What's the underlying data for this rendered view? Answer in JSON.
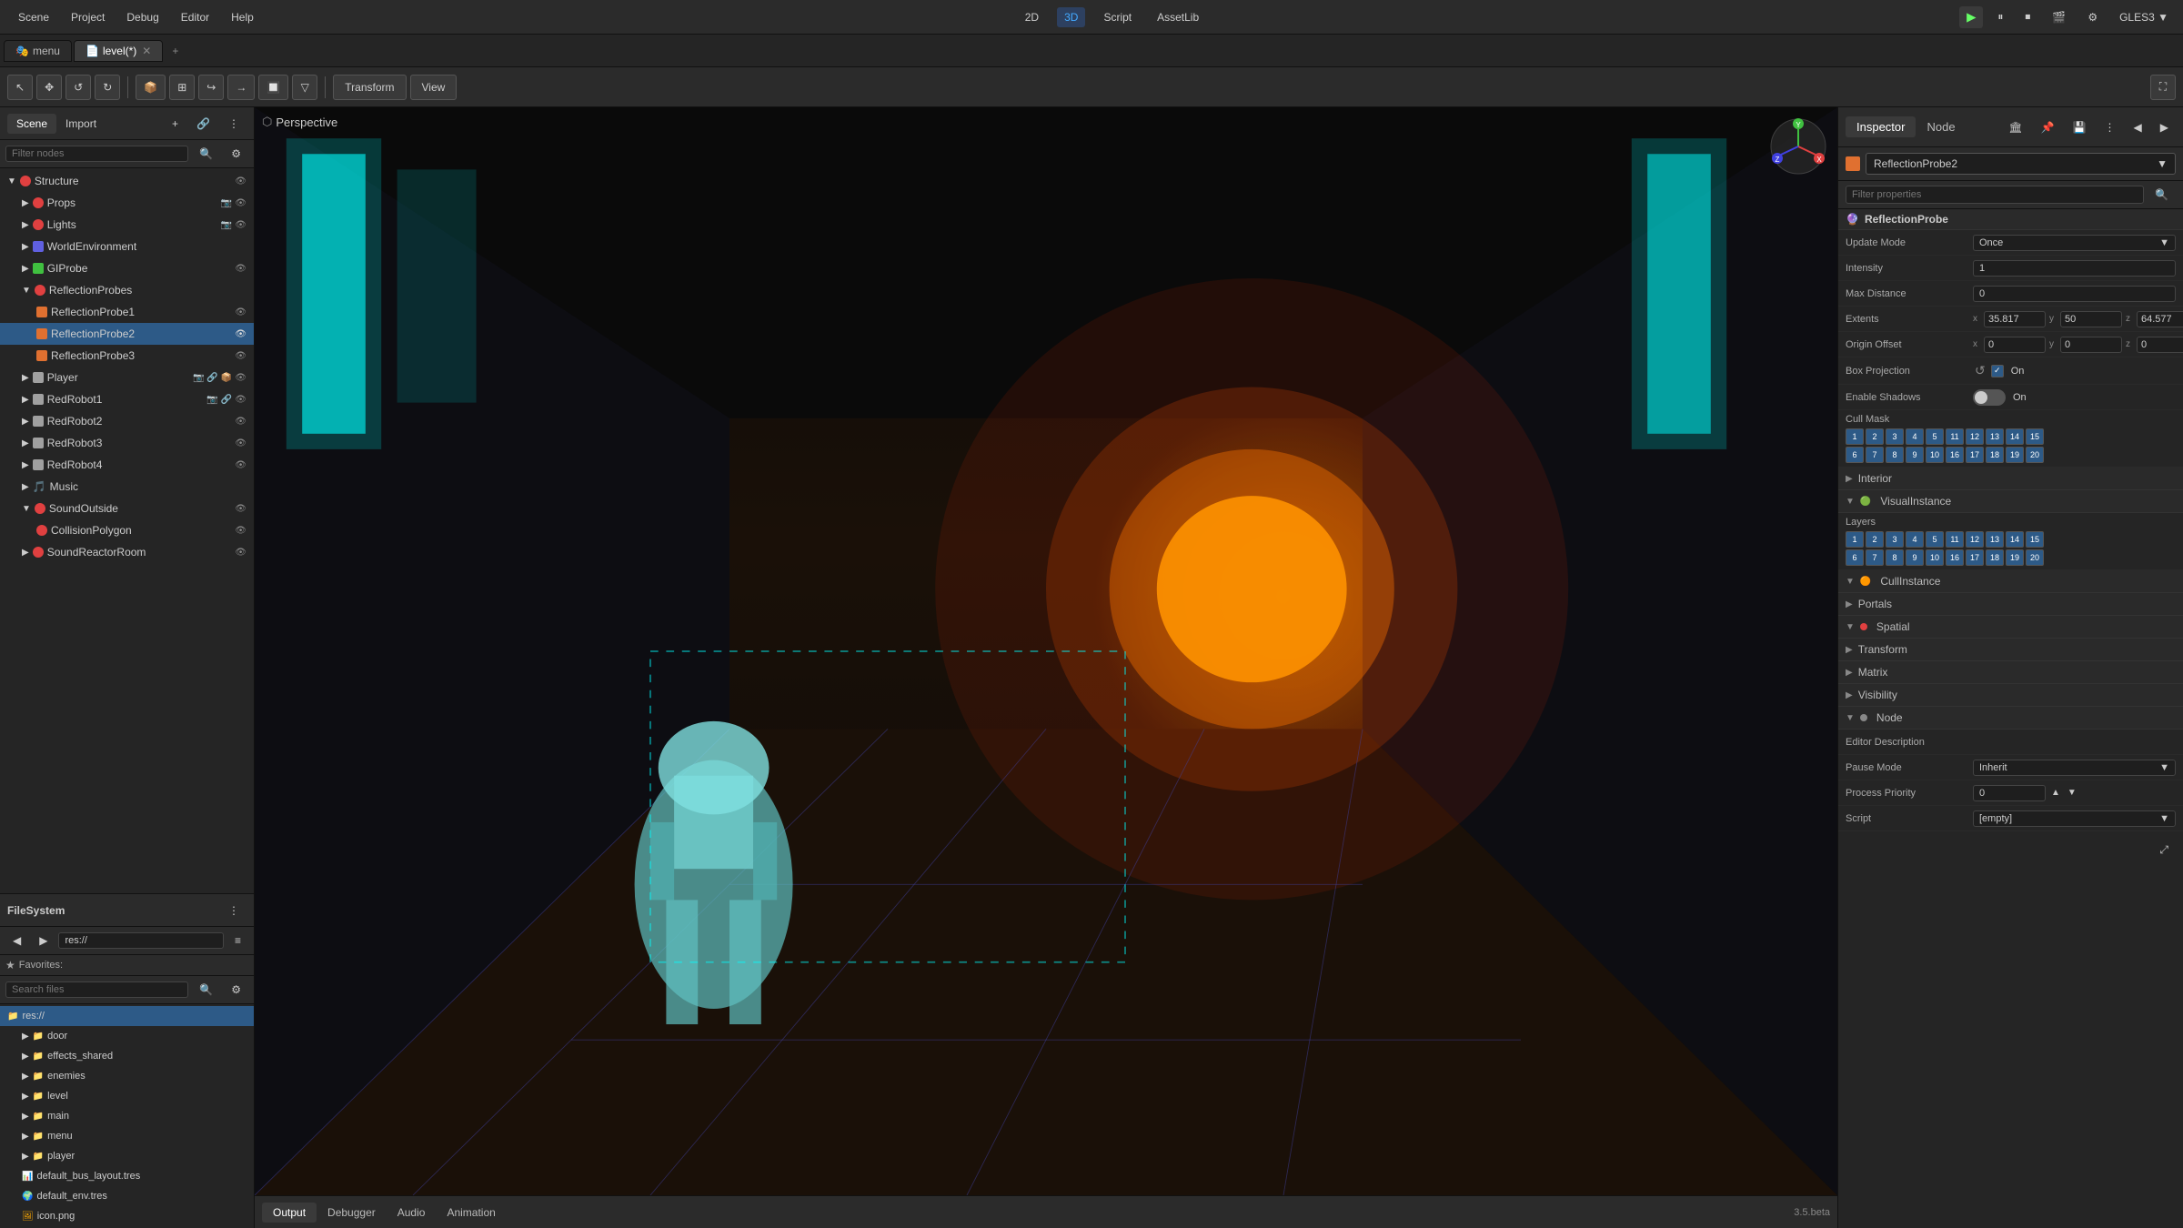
{
  "topbar": {
    "menu_items": [
      "Scene",
      "Project",
      "Debug",
      "Editor",
      "Help"
    ],
    "center": {
      "mode_2d": "2D",
      "mode_3d": "3D",
      "script": "Script",
      "assetlib": "AssetLib"
    },
    "right": {
      "renderer": "GLES3 ▼"
    },
    "run_icon": "▶",
    "pause_icon": "⏸",
    "stop_icon": "⏹",
    "movie_icon": "🎬",
    "settings_icon": "⚙"
  },
  "tabs": {
    "items": [
      {
        "label": "menu",
        "icon": "🎭",
        "active": false,
        "closeable": false
      },
      {
        "label": "level(*)",
        "icon": "📄",
        "active": true,
        "closeable": true
      }
    ],
    "add_label": "+"
  },
  "toolbar": {
    "tools": [
      "↖",
      "✥",
      "↺",
      "↻",
      "📦",
      "⊞",
      "↪",
      "→",
      "🔲",
      "▽"
    ],
    "transform_label": "Transform",
    "view_label": "View"
  },
  "scene_panel": {
    "tabs": [
      "Scene",
      "Import"
    ],
    "active_tab": "Scene",
    "filter_placeholder": "Filter nodes",
    "tree": [
      {
        "label": "Structure",
        "icon": "🔴",
        "indent": 0,
        "type": "node",
        "has_eye": true,
        "expanded": true
      },
      {
        "label": "Props",
        "icon": "🔴",
        "indent": 1,
        "type": "node",
        "has_eye": true,
        "expanded": false
      },
      {
        "label": "Lights",
        "icon": "🔴",
        "indent": 1,
        "type": "node",
        "has_eye": true,
        "expanded": false
      },
      {
        "label": "WorldEnvironment",
        "icon": "🌍",
        "indent": 1,
        "type": "node",
        "has_eye": false,
        "expanded": false
      },
      {
        "label": "GIProbe",
        "icon": "🟢",
        "indent": 1,
        "type": "node",
        "has_eye": true,
        "expanded": false
      },
      {
        "label": "ReflectionProbes",
        "icon": "🔴",
        "indent": 1,
        "type": "node",
        "has_eye": false,
        "expanded": true
      },
      {
        "label": "ReflectionProbe1",
        "icon": "🔴",
        "indent": 2,
        "type": "node",
        "has_eye": true,
        "expanded": false
      },
      {
        "label": "ReflectionProbe2",
        "icon": "🔴",
        "indent": 2,
        "type": "node",
        "has_eye": true,
        "expanded": false,
        "selected": true
      },
      {
        "label": "ReflectionProbe3",
        "icon": "🔴",
        "indent": 2,
        "type": "node",
        "has_eye": true,
        "expanded": false
      },
      {
        "label": "Player",
        "icon": "⬜",
        "indent": 1,
        "type": "node",
        "has_eye": true,
        "expanded": false
      },
      {
        "label": "RedRobot1",
        "icon": "⬜",
        "indent": 1,
        "type": "node",
        "has_eye": true,
        "expanded": false
      },
      {
        "label": "RedRobot2",
        "icon": "⬜",
        "indent": 1,
        "type": "node",
        "has_eye": true,
        "expanded": false
      },
      {
        "label": "RedRobot3",
        "icon": "⬜",
        "indent": 1,
        "type": "node",
        "has_eye": true,
        "expanded": false
      },
      {
        "label": "RedRobot4",
        "icon": "⬜",
        "indent": 1,
        "type": "node",
        "has_eye": true,
        "expanded": false
      },
      {
        "label": "Music",
        "icon": "🎵",
        "indent": 1,
        "type": "node",
        "has_eye": false,
        "expanded": false
      },
      {
        "label": "SoundOutside",
        "icon": "🔴",
        "indent": 1,
        "type": "node",
        "has_eye": true,
        "expanded": true
      },
      {
        "label": "CollisionPolygon",
        "icon": "🔴",
        "indent": 2,
        "type": "node",
        "has_eye": true,
        "expanded": false
      },
      {
        "label": "SoundReactorRoom",
        "icon": "🔴",
        "indent": 1,
        "type": "node",
        "has_eye": true,
        "expanded": false
      }
    ]
  },
  "filesystem_panel": {
    "title": "FileSystem",
    "path": "res://",
    "search_placeholder": "Search files",
    "favorites_label": "Favorites:",
    "items": [
      {
        "label": "res://",
        "icon": "📁",
        "indent": 0,
        "type": "folder",
        "expanded": true,
        "selected": true
      },
      {
        "label": "door",
        "icon": "📁",
        "indent": 1,
        "type": "folder",
        "expanded": false
      },
      {
        "label": "effects_shared",
        "icon": "📁",
        "indent": 1,
        "type": "folder",
        "expanded": false
      },
      {
        "label": "enemies",
        "icon": "📁",
        "indent": 1,
        "type": "folder",
        "expanded": false
      },
      {
        "label": "level",
        "icon": "📁",
        "indent": 1,
        "type": "folder",
        "expanded": false
      },
      {
        "label": "main",
        "icon": "📁",
        "indent": 1,
        "type": "folder",
        "expanded": false
      },
      {
        "label": "menu",
        "icon": "📁",
        "indent": 1,
        "type": "folder",
        "expanded": false
      },
      {
        "label": "player",
        "icon": "📁",
        "indent": 1,
        "type": "folder",
        "expanded": false
      },
      {
        "label": "default_bus_layout.tres",
        "icon": "📊",
        "indent": 1,
        "type": "file"
      },
      {
        "label": "default_env.tres",
        "icon": "🌍",
        "indent": 1,
        "type": "file"
      },
      {
        "label": "icon.png",
        "icon": "🖼",
        "indent": 1,
        "type": "file"
      }
    ]
  },
  "viewport": {
    "perspective_label": "Perspective",
    "gizmo_colors": {
      "x": "#e04040",
      "y": "#40c040",
      "z": "#4040e0"
    }
  },
  "inspector": {
    "tabs": [
      "Inspector",
      "Node"
    ],
    "active_tab": "Inspector",
    "selected_node": "ReflectionProbe2",
    "filter_placeholder": "Filter properties",
    "section_label": "ReflectionProbe",
    "properties": {
      "update_mode": {
        "label": "Update Mode",
        "value": "Once"
      },
      "intensity": {
        "label": "Intensity",
        "value": "1"
      },
      "max_distance": {
        "label": "Max Distance",
        "value": "0"
      },
      "extents": {
        "label": "Extents",
        "x": "35.817",
        "y": "50",
        "z": "64.577"
      },
      "origin_offset": {
        "label": "Origin Offset",
        "x": "0",
        "y": "0",
        "z": "0"
      },
      "box_projection": {
        "label": "Box Projection",
        "value": "On",
        "enabled": true
      },
      "enable_shadows": {
        "label": "Enable Shadows",
        "value": "On",
        "enabled": false
      },
      "cull_mask": {
        "label": "Cull Mask",
        "rows": [
          [
            {
              "num": 1,
              "on": true
            },
            {
              "num": 2,
              "on": true
            },
            {
              "num": 3,
              "on": true
            },
            {
              "num": 4,
              "on": true
            },
            {
              "num": 5,
              "on": true
            },
            {
              "num": 11,
              "on": true
            },
            {
              "num": 12,
              "on": true
            },
            {
              "num": 13,
              "on": true
            },
            {
              "num": 14,
              "on": true
            },
            {
              "num": 15,
              "on": true
            }
          ],
          [
            {
              "num": 6,
              "on": true
            },
            {
              "num": 7,
              "on": true
            },
            {
              "num": 8,
              "on": true
            },
            {
              "num": 9,
              "on": true
            },
            {
              "num": 10,
              "on": true
            },
            {
              "num": 16,
              "on": true
            },
            {
              "num": 17,
              "on": true
            },
            {
              "num": 18,
              "on": true
            },
            {
              "num": 19,
              "on": true
            },
            {
              "num": 20,
              "on": true
            }
          ]
        ]
      }
    },
    "sections": [
      {
        "label": "Interior",
        "collapsed": true
      },
      {
        "label": "VisualInstance",
        "collapsed": false
      },
      {
        "label": "Layers",
        "type": "layers"
      },
      {
        "label": "CullInstance",
        "collapsed": false
      },
      {
        "label": "Portals",
        "collapsed": true
      },
      {
        "label": "Spatial",
        "collapsed": false
      },
      {
        "label": "Transform",
        "collapsed": true
      },
      {
        "label": "Matrix",
        "collapsed": true
      },
      {
        "label": "Visibility",
        "collapsed": true
      },
      {
        "label": "Node",
        "collapsed": false
      }
    ],
    "bottom": {
      "editor_description": {
        "label": "Editor Description"
      },
      "pause_mode": {
        "label": "Pause Mode",
        "value": "Inherit"
      },
      "process_priority": {
        "label": "Process Priority",
        "value": "0"
      },
      "script": {
        "label": "Script",
        "value": "[empty]"
      }
    }
  },
  "bottom_bar": {
    "tabs": [
      "Output",
      "Debugger",
      "Audio",
      "Animation"
    ],
    "active_tab": "Output",
    "version": "3.5.beta"
  }
}
